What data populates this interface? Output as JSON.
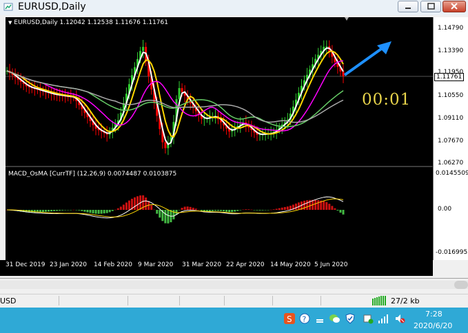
{
  "window": {
    "title": "EURUSD,Daily"
  },
  "chart": {
    "header": "EURUSD,Daily  1.12042 1.12538 1.11676 1.11761",
    "countdown": "00:01",
    "price_axis": [
      "1.14790",
      "1.13390",
      "1.11950",
      "1.10550",
      "1.09110",
      "1.07670",
      "1.06270"
    ],
    "current_price": "1.11761",
    "indicator_header": "MACD_OsMA [CurrTF] (12,26,9) 0.0074487 0.0103875",
    "indicator_axis": [
      "0.0145509",
      "0.00",
      "-0.016995"
    ],
    "date_axis": [
      "31 Dec 2019",
      "23 Jan 2020",
      "14 Feb 2020",
      "9 Mar 2020",
      "31 Mar 2020",
      "22 Apr 2020",
      "14 May 2020",
      "5 Jun 2020"
    ]
  },
  "status_bar": {
    "symbol": "USD",
    "traffic": "27/2 kb"
  },
  "taskbar": {
    "time": "7:28",
    "date": "2020/6/20"
  },
  "colors": {
    "chart_bg": "#000000",
    "bull_candle": "#32cd32",
    "bear_candle": "#ff0000",
    "ma_white": "#ffffff",
    "ma_yellow": "#ffd700",
    "ma_magenta": "#ff00ff",
    "ma_green": "#66cc66",
    "ma_gray": "#aaaaaa",
    "arrow": "#1e90ff",
    "countdown": "#e8d44b",
    "taskbar": "#2fa9d6"
  },
  "chart_data": {
    "type": "candlestick",
    "symbol": "EURUSD",
    "timeframe": "Daily",
    "x_range": [
      "31 Dec 2019",
      "19 Jun 2020"
    ],
    "ylim": [
      1.0627,
      1.1479
    ],
    "ohlc_last": {
      "open": 1.12042,
      "high": 1.12538,
      "low": 1.11676,
      "close": 1.11761
    },
    "close_path": [
      [
        "31 Dec 2019",
        1.121
      ],
      [
        "10 Jan 2020",
        1.111
      ],
      [
        "23 Jan 2020",
        1.106
      ],
      [
        "3 Feb 2020",
        1.104
      ],
      [
        "14 Feb 2020",
        1.084
      ],
      [
        "20 Feb 2020",
        1.08
      ],
      [
        "26 Feb 2020",
        1.09
      ],
      [
        "3 Mar 2020",
        1.116
      ],
      [
        "9 Mar 2020",
        1.138
      ],
      [
        "12 Mar 2020",
        1.118
      ],
      [
        "20 Mar 2020",
        1.07
      ],
      [
        "24 Mar 2020",
        1.08
      ],
      [
        "27 Mar 2020",
        1.111
      ],
      [
        "31 Mar 2020",
        1.104
      ],
      [
        "8 Apr 2020",
        1.09
      ],
      [
        "15 Apr 2020",
        1.092
      ],
      [
        "22 Apr 2020",
        1.082
      ],
      [
        "29 Apr 2020",
        1.088
      ],
      [
        "6 May 2020",
        1.08
      ],
      [
        "14 May 2020",
        1.081
      ],
      [
        "22 May 2020",
        1.09
      ],
      [
        "29 May 2020",
        1.112
      ],
      [
        "5 Jun 2020",
        1.129
      ],
      [
        "10 Jun 2020",
        1.138
      ],
      [
        "15 Jun 2020",
        1.126
      ],
      [
        "19 Jun 2020",
        1.1176
      ]
    ],
    "indicator": {
      "name": "MACD_OsMA [CurrTF] (12,26,9)",
      "ylim": [
        -0.016995,
        0.0145509
      ],
      "values_shown": [
        0.0074487,
        0.0103875
      ]
    }
  }
}
